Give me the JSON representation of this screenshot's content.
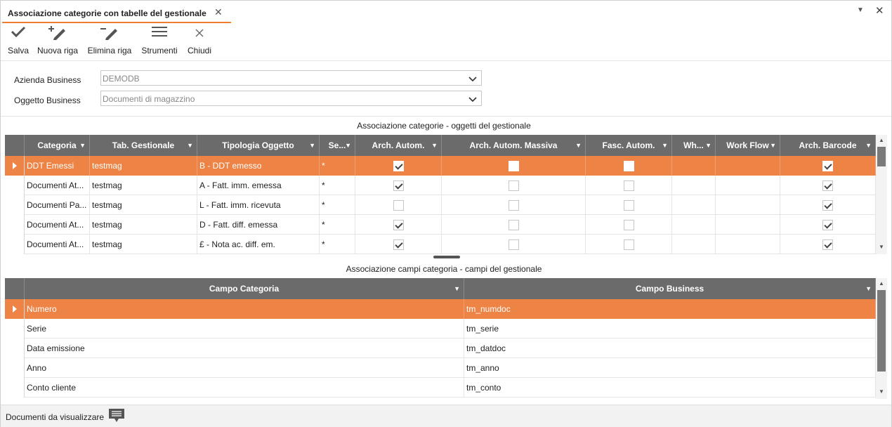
{
  "tab": {
    "title": "Associazione categorie con tabelle del gestionale",
    "close": "✕"
  },
  "window": {
    "pin": "▼",
    "close": "✕"
  },
  "toolbar": {
    "save_label": "Salva",
    "new_row_label": "Nuova riga",
    "delete_row_label": "Elimina riga",
    "tools_label": "Strumenti",
    "close_label": "Chiudi",
    "icons": [
      "check-icon",
      "add-pencil-icon",
      "remove-pencil-icon",
      "hamburger-icon",
      "close-icon"
    ]
  },
  "form": {
    "azienda_label": "Azienda Business",
    "azienda_value": "DEMODB",
    "oggetto_label": "Oggetto Business",
    "oggetto_value": "Documenti di magazzino"
  },
  "grid1": {
    "title": "Associazione categorie - oggetti del gestionale",
    "columns": [
      "Categoria",
      "Tab. Gestionale",
      "Tipologia Oggetto",
      "Se...",
      "Arch. Autom.",
      "Arch. Autom. Massiva",
      "Fasc. Autom.",
      "Wh...",
      "Work Flow",
      "Arch. Barcode"
    ],
    "rows": [
      {
        "categoria": "DDT Emessi",
        "tab": "testmag",
        "tipologia": "B - DDT emesso",
        "serie": "*",
        "arch": true,
        "massiva": false,
        "fasc": false,
        "barcode": true
      },
      {
        "categoria": "Documenti At...",
        "tab": "testmag",
        "tipologia": "A - Fatt. imm. emessa",
        "serie": "*",
        "arch": true,
        "massiva": false,
        "fasc": false,
        "barcode": true
      },
      {
        "categoria": "Documenti Pa...",
        "tab": "testmag",
        "tipologia": "L - Fatt. imm. ricevuta",
        "serie": "*",
        "arch": false,
        "massiva": false,
        "fasc": false,
        "barcode": true
      },
      {
        "categoria": "Documenti At...",
        "tab": "testmag",
        "tipologia": "D - Fatt. diff. emessa",
        "serie": "*",
        "arch": true,
        "massiva": false,
        "fasc": false,
        "barcode": true
      },
      {
        "categoria": "Documenti At...",
        "tab": "testmag",
        "tipologia": "£ - Nota ac. diff. em.",
        "serie": "*",
        "arch": true,
        "massiva": false,
        "fasc": false,
        "barcode": true
      }
    ]
  },
  "grid2": {
    "title": "Associazione campi categoria - campi del gestionale",
    "columns": [
      "Campo Categoria",
      "Campo Business"
    ],
    "rows": [
      {
        "categoria": "Numero",
        "business": "tm_numdoc"
      },
      {
        "categoria": "Serie",
        "business": "tm_serie"
      },
      {
        "categoria": "Data emissione",
        "business": "tm_datdoc"
      },
      {
        "categoria": "Anno",
        "business": "tm_anno"
      },
      {
        "categoria": "Conto cliente",
        "business": "tm_conto"
      }
    ]
  },
  "status": {
    "label": "Documenti da visualizzare",
    "icon": "comment-icon"
  },
  "colors": {
    "accent": "#ed8446",
    "header": "#6b6b6b"
  }
}
